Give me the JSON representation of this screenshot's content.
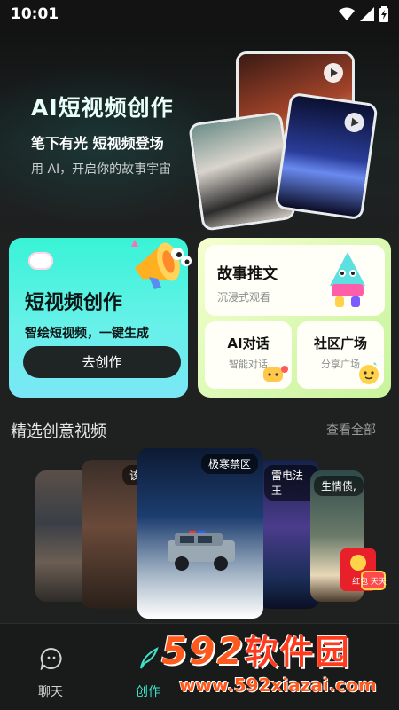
{
  "status": {
    "time": "10:01"
  },
  "hero": {
    "title": "AI短视频创作",
    "subtitle": "笔下有光 短视频登场",
    "description": "用 AI，开启你的故事宇宙"
  },
  "cards": {
    "main": {
      "title": "短视频创作",
      "subtitle": "智绘短视频，一键生成",
      "button_label": "去创作"
    },
    "story": {
      "title": "故事推文",
      "subtitle": "沉浸式观看"
    },
    "ai_chat": {
      "title": "AI对话",
      "subtitle": "智能对话"
    },
    "community": {
      "title": "社区广场",
      "subtitle": "分享广场"
    }
  },
  "section": {
    "title": "精选创意视频",
    "more_label": "查看全部"
  },
  "videos": [
    {
      "label": ""
    },
    {
      "label": "该"
    },
    {
      "label": "极寒禁区"
    },
    {
      "label": "雷电法王"
    },
    {
      "label": "生情债,"
    }
  ],
  "redpack": {
    "text": "红包 天天领"
  },
  "tabs": [
    {
      "label": "聊天"
    },
    {
      "label": "创作"
    }
  ],
  "watermark": {
    "brand_number": "592",
    "brand_text": "软件园",
    "url": "www.592xiazai.com"
  },
  "colors": {
    "accent": "#3ee3c7",
    "background": "#1f2020",
    "main_card": "#38f3d6",
    "side_card": "#d8f8b0"
  }
}
